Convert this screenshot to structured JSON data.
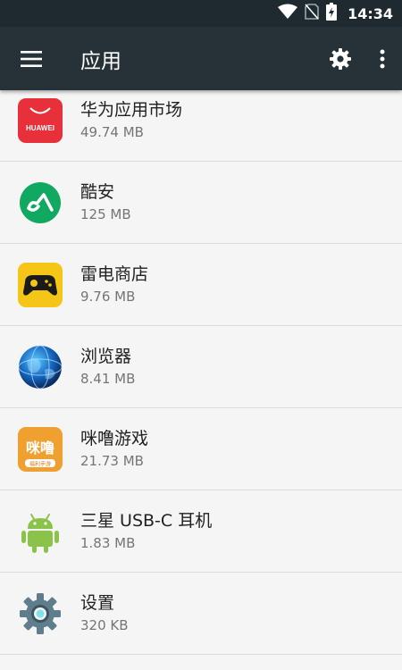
{
  "status_bar": {
    "time": "14:34"
  },
  "toolbar": {
    "title": "应用"
  },
  "apps": [
    {
      "name": "华为应用市场",
      "size": "49.74 MB",
      "icon": "huawei-appgallery-icon",
      "badge_text": "HUAWEI"
    },
    {
      "name": "酷安",
      "size": "125 MB",
      "icon": "coolapk-icon"
    },
    {
      "name": "雷电商店",
      "size": "9.76 MB",
      "icon": "leidian-store-icon"
    },
    {
      "name": "浏览器",
      "size": "8.41 MB",
      "icon": "browser-icon"
    },
    {
      "name": "咪噜游戏",
      "size": "21.73 MB",
      "icon": "milu-game-icon",
      "badge_text": "咪噜",
      "badge_sub": "福利手游"
    },
    {
      "name": "三星 USB-C 耳机",
      "size": "1.83 MB",
      "icon": "android-icon"
    },
    {
      "name": "设置",
      "size": "320 KB",
      "icon": "settings-gear-icon"
    }
  ],
  "colors": {
    "toolbar": "#263238",
    "status_bar": "#1f2a30",
    "background": "#f5f5f5",
    "huawei_red": "#e8303a",
    "coolapk_green": "#11a862",
    "leidian_yellow": "#f5c518",
    "milu_orange": "#f0a030",
    "android_green": "#8bc34a"
  }
}
